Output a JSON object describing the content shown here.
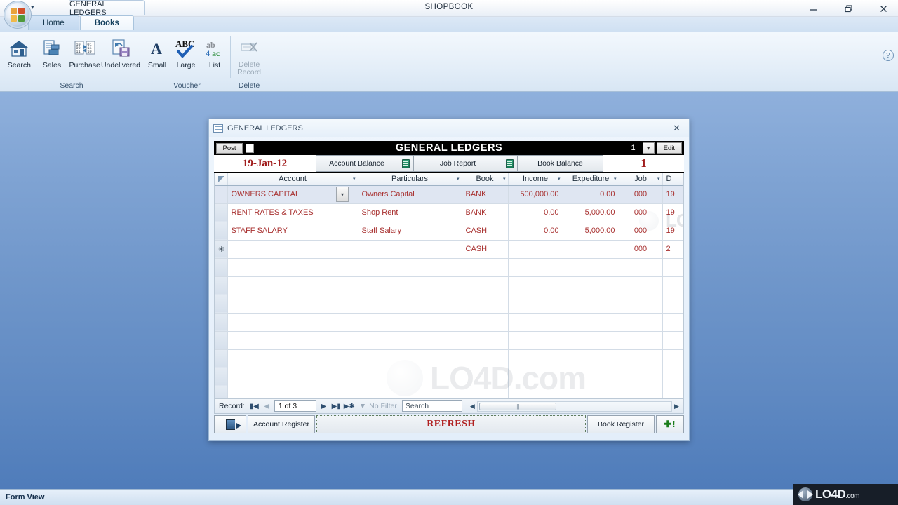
{
  "window": {
    "title": "SHOPBOOK",
    "minimize_icon": "minimize-icon",
    "restore_icon": "restore-icon",
    "close_icon": "close-icon",
    "help_icon": "help-icon",
    "help_label": "?"
  },
  "quick_access": {
    "dropdown_icon": "chevron-down-icon"
  },
  "document_tab": {
    "label": "GENERAL LEDGERS"
  },
  "ribbon": {
    "tabs": [
      {
        "label": "Home",
        "active": false
      },
      {
        "label": "Books",
        "active": true
      }
    ],
    "groups": [
      {
        "label": "Search",
        "items": [
          {
            "label": "Search",
            "icon": "house-icon"
          },
          {
            "label": "Sales",
            "icon": "documents-stack-icon"
          },
          {
            "label": "Purchase",
            "icon": "binary-exchange-icon"
          },
          {
            "label": "Undelivered",
            "icon": "document-save-icon"
          }
        ]
      },
      {
        "label": "Voucher",
        "items": [
          {
            "label": "Small",
            "icon": "letter-a-icon"
          },
          {
            "label": "Large",
            "icon": "abc-check-icon"
          },
          {
            "label": "List",
            "icon": "ab-ac-list-icon"
          }
        ]
      },
      {
        "label": "Delete",
        "items": [
          {
            "label": "Delete Record",
            "icon": "delete-record-icon",
            "disabled": true
          }
        ]
      }
    ]
  },
  "form": {
    "title": "GENERAL LEDGERS",
    "icon": "form-window-icon",
    "close_label": "✕",
    "postbar": {
      "post_label": "Post",
      "checkbox_checked": false,
      "heading": "GENERAL LEDGERS",
      "number": "1",
      "dropdown_icon": "chevron-down-icon",
      "edit_label": "Edit"
    },
    "toolbar": {
      "date": "19-Jan-12",
      "account_balance_label": "Account Balance",
      "job_report_label": "Job Report",
      "book_balance_label": "Book Balance",
      "calc_icon": "calculator-icon",
      "voucher_number": "1"
    },
    "grid": {
      "columns": [
        {
          "label": "Account",
          "sort_icon": "sort-arrow-icon"
        },
        {
          "label": "Particulars",
          "sort_icon": "sort-arrow-icon"
        },
        {
          "label": "Book",
          "sort_icon": "sort-arrow-icon"
        },
        {
          "label": "Income",
          "sort_icon": "sort-arrow-icon"
        },
        {
          "label": "Expediture",
          "sort_icon": "sort-arrow-icon"
        },
        {
          "label": "Job",
          "sort_icon": "sort-arrow-icon"
        },
        {
          "label": "D",
          "sort_icon": "sort-arrow-icon"
        }
      ],
      "rows": [
        {
          "selected": true,
          "account": "OWNERS CAPITAL",
          "particulars": "Owners Capital",
          "book": "BANK",
          "income": "500,000.00",
          "expediture": "0.00",
          "job": "000",
          "date": "19"
        },
        {
          "selected": false,
          "account": "RENT RATES & TAXES",
          "particulars": "Shop Rent",
          "book": "BANK",
          "income": "0.00",
          "expediture": "5,000.00",
          "job": "000",
          "date": "19"
        },
        {
          "selected": false,
          "account": "STAFF SALARY",
          "particulars": "Staff Salary",
          "book": "CASH",
          "income": "0.00",
          "expediture": "5,000.00",
          "job": "000",
          "date": "19"
        },
        {
          "selected": false,
          "new_record": true,
          "account": "",
          "particulars": "",
          "book": "CASH",
          "income": "",
          "expediture": "",
          "job": "000",
          "date": "2"
        }
      ],
      "new_record_marker": "✳",
      "cell_dropdown_icon": "chevron-down-icon"
    },
    "nav": {
      "record_label": "Record:",
      "first_icon": "first-record-icon",
      "prev_icon": "previous-record-icon",
      "position": "1 of 3",
      "next_icon": "next-record-icon",
      "last_icon": "last-record-icon",
      "new_icon": "new-record-icon",
      "filter_label": "No Filter",
      "filter_icon": "funnel-icon",
      "search_placeholder": "Search",
      "scroll_left_icon": "scroll-left-icon",
      "scroll_right_icon": "scroll-right-icon"
    },
    "buttons": {
      "exit_icon": "exit-door-icon",
      "account_register": "Account Register",
      "refresh": "REFRESH",
      "book_register": "Book Register",
      "add_icon": "add-plus-icon",
      "add_label": "✚!"
    }
  },
  "status": {
    "view_mode": "Form View"
  },
  "watermark": {
    "text": "LO4D",
    "suffix": ".com"
  }
}
